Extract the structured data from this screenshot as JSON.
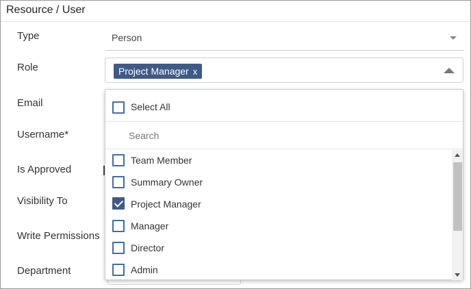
{
  "panel": {
    "title": "Resource / User"
  },
  "form": {
    "labels": {
      "type": "Type",
      "role": "Role",
      "email": "Email",
      "username": "Username*",
      "is_approved": "Is Approved",
      "visibility_to": "Visibility To",
      "write_permissions": "Write Permissions",
      "department": "Department"
    },
    "type_value": "Person",
    "role_chip": {
      "label": "Project Manager",
      "remove": "x"
    }
  },
  "dropdown": {
    "select_all": {
      "label": "Select All",
      "checked": false
    },
    "search": {
      "placeholder": "Search",
      "value": ""
    },
    "options": [
      {
        "label": "Team Member",
        "checked": false
      },
      {
        "label": "Summary Owner",
        "checked": false
      },
      {
        "label": "Project Manager",
        "checked": true
      },
      {
        "label": "Manager",
        "checked": false
      },
      {
        "label": "Director",
        "checked": false
      },
      {
        "label": "Admin",
        "checked": false
      }
    ]
  },
  "colors": {
    "chip_bg": "#3f5a86",
    "checkbox_border": "#3e6ea8",
    "checkbox_checked": "#3f5a86"
  }
}
